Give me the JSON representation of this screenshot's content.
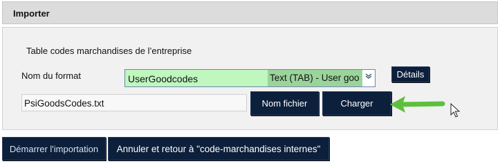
{
  "panel": {
    "title": "Importer"
  },
  "form": {
    "subtitle": "Table codes marchandises de l’entreprise",
    "format_label": "Nom du format",
    "format_select": {
      "name": "UserGoodcodes",
      "type": "Text (TAB) - User goo"
    },
    "details_button": "Détails",
    "file_value": "PsiGoodsCodes.txt",
    "nom_fichier_button": "Nom fichier",
    "charger_button": "Charger"
  },
  "footer": {
    "start_button": "Démarrer l'importation",
    "cancel_button": "Annuler et retour à \"code-marchandises internes\""
  },
  "colors": {
    "button_bg": "#0c1f3b",
    "select_bg": "#bff7bf",
    "select_highlight": "#9bd49b",
    "arrow": "#5cc03d"
  },
  "icons": [
    "chevron-down-icon",
    "green-arrow-icon",
    "mouse-cursor-icon"
  ]
}
